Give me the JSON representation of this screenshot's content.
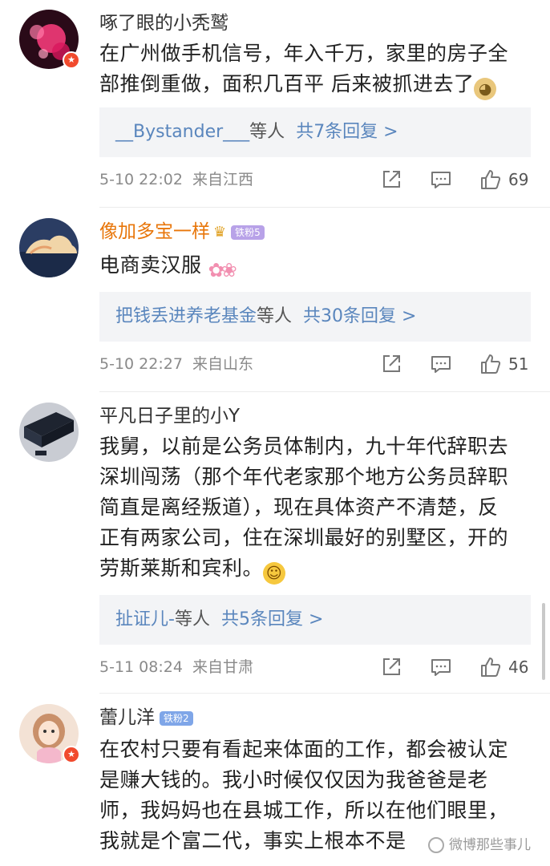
{
  "comments": [
    {
      "username": "啄了眼的小秃鹫",
      "text_lines": [
        "在广州做手机信号，年入千万，家里的房子全",
        "部推倒重做，面积几百平 后来被抓进去了"
      ],
      "reply": {
        "user": "__Bystander___",
        "mid": "等人",
        "count": "共7条回复 >"
      },
      "time": "5-10 22:02",
      "location": "来自江西",
      "likes": "69",
      "avatar_colors": [
        "#2a0a18",
        "#ff3d7f"
      ]
    },
    {
      "username": "像加多宝一样",
      "fan_badge": "铁粉5",
      "text": "电商卖汉服",
      "reply": {
        "user": "把钱丢进养老基金",
        "mid": "等人",
        "count": "共30条回复 >"
      },
      "time": "5-10 22:27",
      "location": "来自山东",
      "likes": "51",
      "avatar_colors": [
        "#2b3d63",
        "#f1d5a8"
      ]
    },
    {
      "username": "平凡日子里的小Y",
      "text_lines": [
        "我舅，以前是公务员体制内，九十年代辞职去",
        "深圳闯荡（那个年代老家那个地方公务员辞职",
        "简直是离经叛道），现在具体资产不清楚，反",
        "正有两家公司，住在深圳最好的别墅区，开的",
        "劳斯莱斯和宾利。"
      ],
      "reply": {
        "user": "扯证儿-",
        "mid": "等人",
        "count": "共5条回复 >"
      },
      "time": "5-11 08:24",
      "location": "来自甘肃",
      "likes": "46",
      "avatar_colors": [
        "#1e2430",
        "#c9ccd3"
      ]
    },
    {
      "username": "蕾儿洋",
      "fan_badge": "铁粉2",
      "text_lines": [
        "在农村只要有看起来体面的工作，都会被认定",
        "是赚大钱的。我小时候仅仅因为我爸爸是老",
        "师，我妈妈也在县城工作，所以在他们眼里，",
        "我就是个富二代，事实上根本不是"
      ],
      "avatar_colors": [
        "#f3e2d5",
        "#c9906a"
      ]
    }
  ],
  "watermark": "微博那些事儿",
  "icons": [
    "share-icon",
    "comment-icon",
    "like-icon",
    "verified-icon",
    "crown-icon",
    "doge-emoji",
    "laugh-cry-emoji",
    "flower-emoji"
  ]
}
